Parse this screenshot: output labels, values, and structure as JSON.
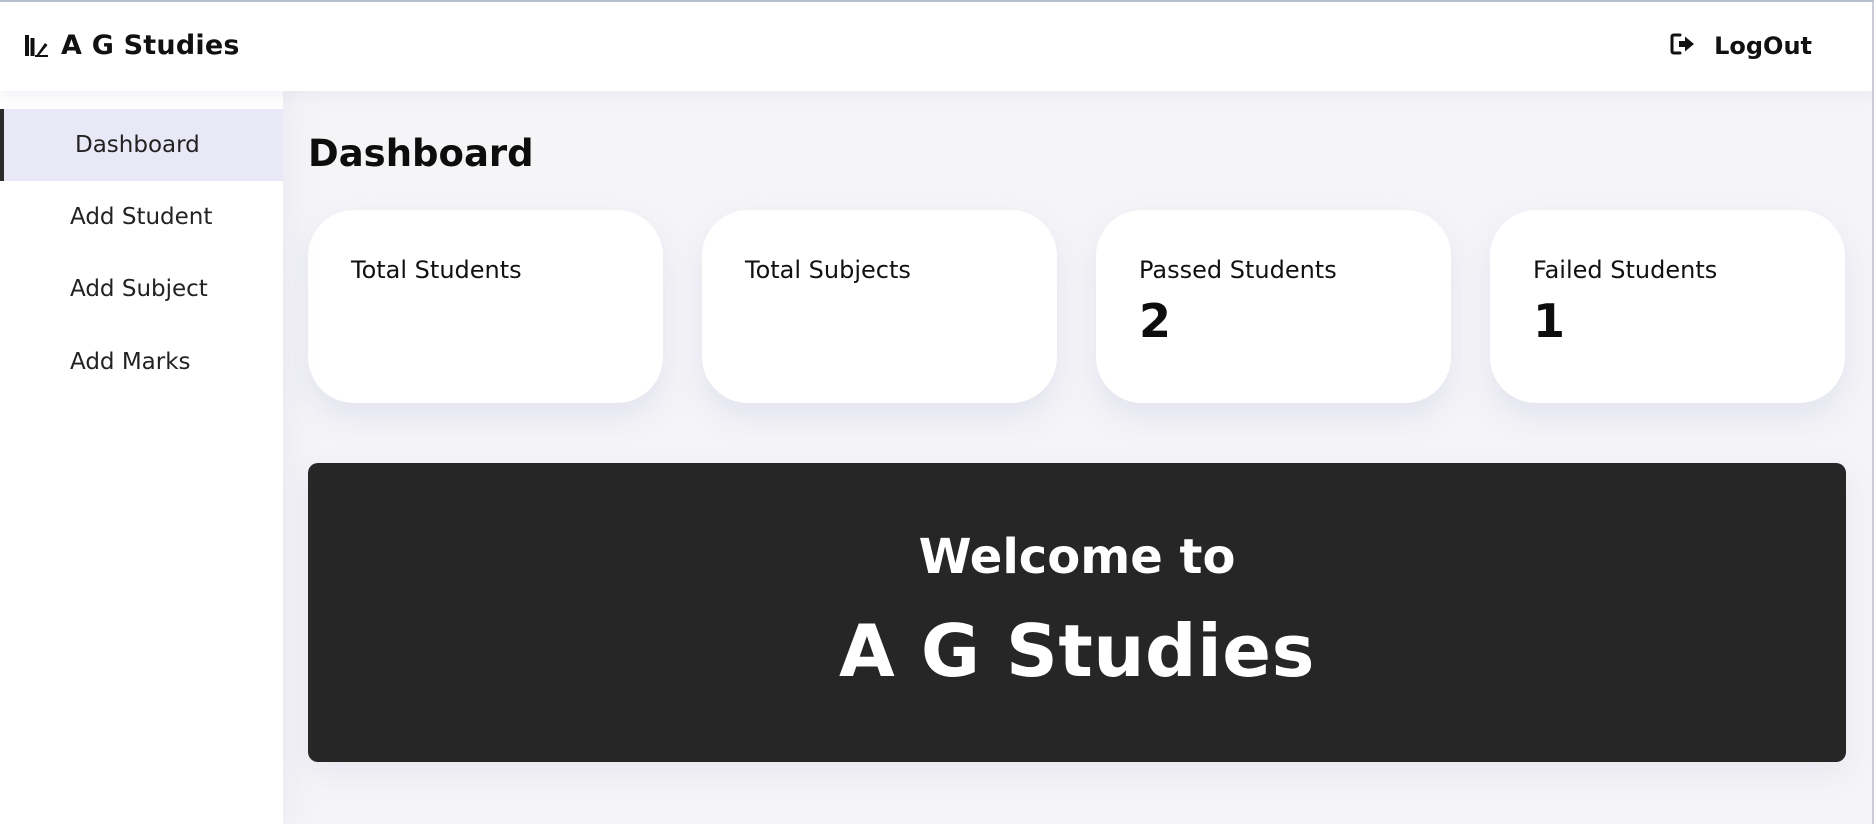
{
  "header": {
    "brand": "A G Studies",
    "brand_icon": "book-pen-icon",
    "logout_label": "LogOut",
    "logout_icon": "logout-arrow-icon"
  },
  "sidebar": {
    "items": [
      {
        "label": "Dashboard",
        "active": true
      },
      {
        "label": "Add Student",
        "active": false
      },
      {
        "label": "Add Subject",
        "active": false
      },
      {
        "label": "Add Marks",
        "active": false
      }
    ]
  },
  "main": {
    "title": "Dashboard",
    "cards": [
      {
        "label": "Total Students",
        "value": ""
      },
      {
        "label": "Total Subjects",
        "value": ""
      },
      {
        "label": "Passed Students",
        "value": "2"
      },
      {
        "label": "Failed Students",
        "value": "1"
      }
    ],
    "banner": {
      "line1": "Welcome to",
      "line2": "A G Studies"
    }
  },
  "colors": {
    "page_bg": "#f5f5f8",
    "banner_bg": "#262626",
    "active_item_bg": "#e8e8f7",
    "active_item_border": "#2b2b2b"
  }
}
